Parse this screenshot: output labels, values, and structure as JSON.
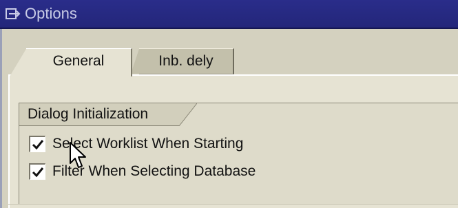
{
  "window": {
    "title": "Options"
  },
  "tabs": [
    {
      "label": "General",
      "active": true
    },
    {
      "label": "Inb. dely",
      "active": false
    }
  ],
  "group": {
    "title": "Dialog Initialization",
    "options": [
      {
        "label": "Select Worklist When Starting",
        "checked": true
      },
      {
        "label": "Filter When Selecting Database",
        "checked": true
      }
    ]
  },
  "colors": {
    "titlebar": "#23267a",
    "panel": "#e6e3d3"
  },
  "icons": {
    "title": "options-window-icon",
    "cursor": "mouse-pointer-icon"
  }
}
